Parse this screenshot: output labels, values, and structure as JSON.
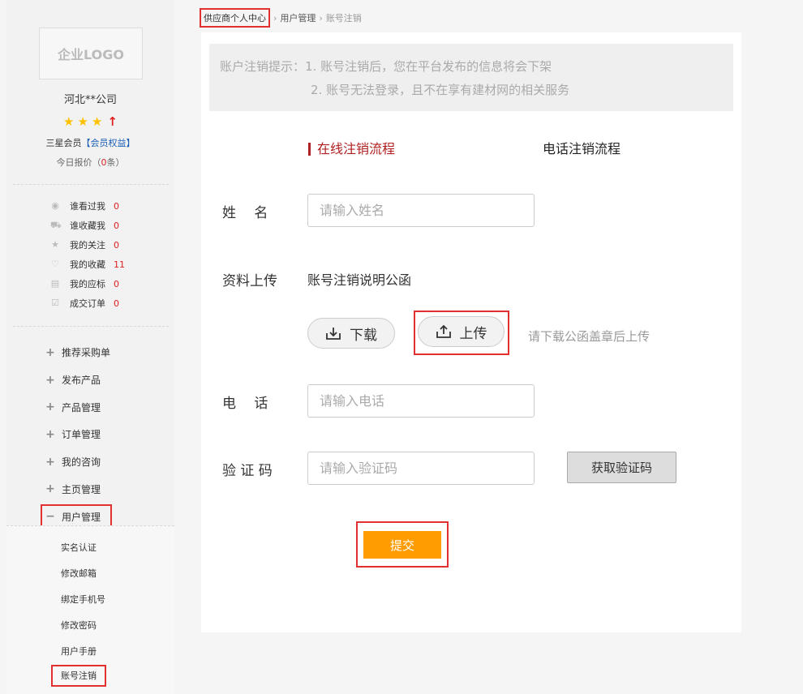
{
  "sidebar": {
    "logo_text": "企业LOGO",
    "company_name": "河北**公司",
    "member_level": "三星会员",
    "member_link": "【会员权益】",
    "quote_prefix": "今日报价（",
    "quote_count": "0",
    "quote_suffix": "条）",
    "stats": [
      {
        "label": "谁看过我",
        "count": "0",
        "icon": "eye-icon"
      },
      {
        "label": "谁收藏我",
        "count": "0",
        "icon": "cart-icon"
      },
      {
        "label": "我的关注",
        "count": "0",
        "icon": "star-icon"
      },
      {
        "label": "我的收藏",
        "count": "11",
        "icon": "heart-icon"
      },
      {
        "label": "我的应标",
        "count": "0",
        "icon": "document-icon"
      },
      {
        "label": "成交订单",
        "count": "0",
        "icon": "check-icon"
      }
    ],
    "menu": [
      {
        "label": "推荐采购单"
      },
      {
        "label": "发布产品"
      },
      {
        "label": "产品管理"
      },
      {
        "label": "订单管理"
      },
      {
        "label": "我的咨询"
      },
      {
        "label": "主页管理"
      },
      {
        "label": "用户管理"
      }
    ],
    "sub_menu": [
      {
        "label": "实名认证"
      },
      {
        "label": "修改邮箱"
      },
      {
        "label": "绑定手机号"
      },
      {
        "label": "修改密码"
      },
      {
        "label": "用户手册"
      },
      {
        "label": "账号注销"
      }
    ]
  },
  "breadcrumb": {
    "home": "供应商个人中心",
    "sep": "›",
    "level2": "用户管理",
    "current": "账号注销"
  },
  "notice": {
    "line1": "账户注销提示：1. 账号注销后，您在平台发布的信息将会下架",
    "line2": "2. 账号无法登录，且不在享有建材网的相关服务"
  },
  "tabs": {
    "online": "在线注销流程",
    "phone": "电话注销流程"
  },
  "form": {
    "name_label": "姓　 名",
    "name_placeholder": "请输入姓名",
    "upload_label": "资料上传",
    "upload_doc": "账号注销说明公函",
    "download_label": "下载",
    "upload_button": "上传",
    "upload_hint": "请下载公函盖章后上传",
    "phone_label": "电　 话",
    "phone_placeholder": "请输入电话",
    "code_label": "验 证 码",
    "code_placeholder": "请输入验证码",
    "get_code": "获取验证码",
    "submit": "提交"
  },
  "colors": {
    "highlight": "#e03030",
    "accent_red": "#b02020",
    "submit_orange": "#ff9d00",
    "link_blue": "#1a5fb4"
  }
}
